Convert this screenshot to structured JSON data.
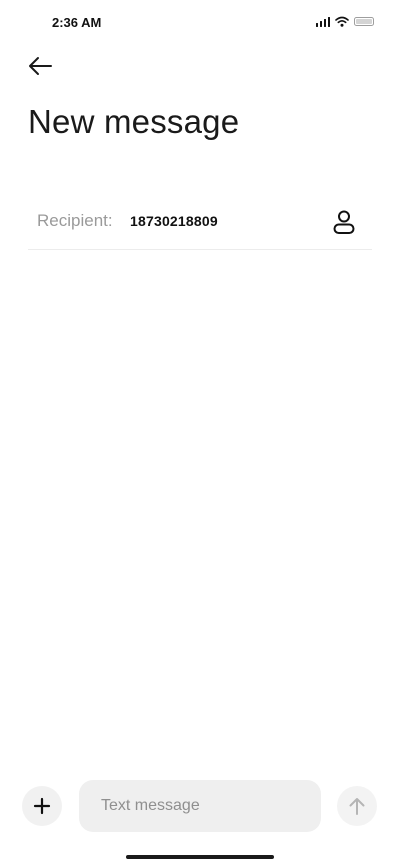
{
  "status_bar": {
    "time": "2:36 AM",
    "icons": [
      "signal-icon",
      "wifi-icon",
      "battery-icon"
    ]
  },
  "header": {
    "back_icon": "arrow-left-icon",
    "title": "New message"
  },
  "recipient": {
    "label": "Recipient:",
    "value": "18730218809",
    "contact_icon": "contact-person-icon"
  },
  "composer": {
    "attach_icon": "plus-icon",
    "placeholder": "Text message",
    "value": "",
    "send_icon": "arrow-up-icon"
  },
  "colors": {
    "background": "#ffffff",
    "text_primary": "#111111",
    "text_secondary": "#9a9a9a",
    "input_background": "#efefef",
    "button_background": "#f1f1f1",
    "divider": "#ececec"
  }
}
